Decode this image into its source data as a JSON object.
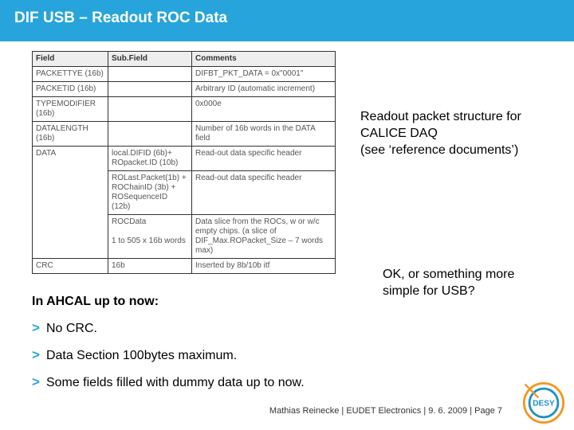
{
  "title": "DIF USB – Readout ROC Data",
  "table": {
    "headers": [
      "Field",
      "Sub.Field",
      "Comments"
    ],
    "rows": [
      {
        "field": "PACKETTYE (16b)",
        "sub": "",
        "comments": "DIFBT_PKT_DATA = 0x\"0001\""
      },
      {
        "field": "PACKETID (16b)",
        "sub": "",
        "comments": "Arbitrary ID (automatic increment)"
      },
      {
        "field": "TYPEMODIFIER (16b)",
        "sub": "",
        "comments": "0x000e"
      },
      {
        "field": "DATALENGTH (16b)",
        "sub": "",
        "comments": "Number of 16b words in the DATA field"
      },
      {
        "field": "DATA",
        "sub": "local.DIFID (6b)+\nROpacket.ID (10b)",
        "comments": "Read-out data specific header"
      },
      {
        "field": "",
        "sub": "ROLast.Packet(1b) +\nROChainID (3b) +\nROSequenceID (12b)",
        "comments": "Read-out data specific header"
      },
      {
        "field": "",
        "sub": "ROCData\n\n1 to 505 x 16b words",
        "comments": "Data slice from the ROCs, w or w/c empty chips. (a slice of DIF_Max.ROPacket_Size – 7 words max)"
      },
      {
        "field": "CRC",
        "sub": "16b",
        "comments": "Inserted by 8b/10b itf"
      }
    ]
  },
  "rowspans": {
    "data_field_label": "DATA",
    "data_rowspan": 3
  },
  "side1": "Readout packet structure for CALICE DAQ\n(see ‘reference documents’)",
  "ahcal": "In AHCAL up to now:",
  "bullets": [
    "No CRC.",
    "Data Section 100bytes maximum.",
    "Some fields filled with dummy data up to now."
  ],
  "side2": "OK, or something more simple for USB?",
  "footer": "Mathias Reinecke |  EUDET Electronics  |  9. 6. 2009  |  Page 7",
  "logo_name": "DESY"
}
